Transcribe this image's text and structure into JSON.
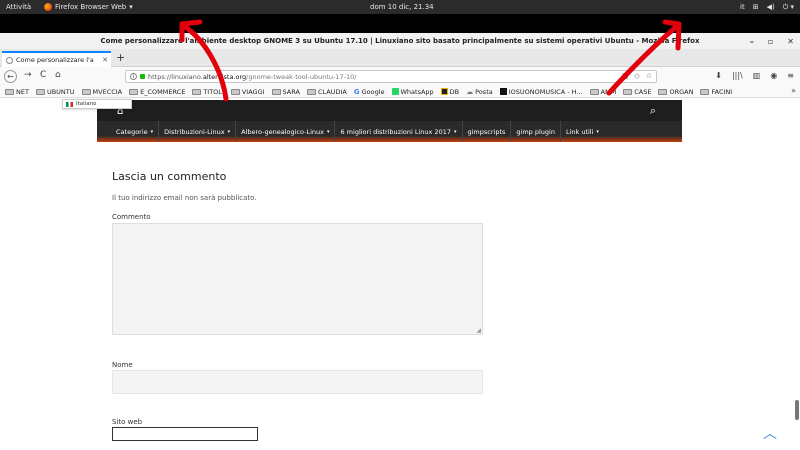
{
  "gnome": {
    "activities": "Attività",
    "app_menu": "Firefox Browser Web",
    "app_menu_caret": "▾",
    "clock": "dom 10 dic, 21.34",
    "lang": "it",
    "tray_net": "⊞",
    "tray_vol": "◀)",
    "tray_power": "⏻ ▾"
  },
  "window": {
    "title": "Come personalizzare l'ambiente desktop GNOME 3 su Ubuntu 17.10 | Linuxiano sito basato principalmente su sistemi operativi Ubuntu - Mozilla Firefox",
    "minimize": "–",
    "maximize": "▫",
    "close": "✕"
  },
  "tabs": [
    {
      "label": "Come personalizzare l'a",
      "close": "✕"
    }
  ],
  "new_tab": "+",
  "nav": {
    "back": "←",
    "forward": "→",
    "reload": "C",
    "home": "⌂",
    "url_prefix": "https://linuxiano.",
    "url_host": "altervista.org",
    "url_path": "/gnome-tweak-tool-ubuntu-17-10/",
    "reader": "▤",
    "pocket": "◇",
    "star": "☆",
    "downloads": "⬇",
    "library": "|||\\",
    "sidebar": "▥",
    "screenshot": "◉",
    "menu": "≡"
  },
  "bookmarks": [
    {
      "label": "NET",
      "icon": "folder"
    },
    {
      "label": "UBUNTU",
      "icon": "folder"
    },
    {
      "label": "MVECCIA",
      "icon": "folder"
    },
    {
      "label": "E_COMMERCE",
      "icon": "folder"
    },
    {
      "label": "TITOLI",
      "icon": "folder"
    },
    {
      "label": "VIAGGI",
      "icon": "folder"
    },
    {
      "label": "SARA",
      "icon": "folder"
    },
    {
      "label": "CLAUDIA",
      "icon": "folder"
    },
    {
      "label": "Google",
      "icon": "google"
    },
    {
      "label": "WhatsApp",
      "icon": "whatsapp"
    },
    {
      "label": "DB",
      "icon": "db"
    },
    {
      "label": "Posta",
      "icon": "mail"
    },
    {
      "label": "IOSUONOMUSICA - H...",
      "icon": "music"
    },
    {
      "label": "AMM",
      "icon": "folder"
    },
    {
      "label": "CASE",
      "icon": "folder"
    },
    {
      "label": "ORGAN",
      "icon": "folder"
    },
    {
      "label": "FACINI",
      "icon": "folder"
    }
  ],
  "bookmarks_more": "»",
  "language_selector": "Italiano",
  "site": {
    "menu": [
      {
        "label": "Categorie",
        "caret": "▾"
      },
      {
        "label": "Distribuzioni-Linux",
        "caret": "▾"
      },
      {
        "label": "Albero-genealogico-Linux",
        "caret": "▾"
      },
      {
        "label": "6 migliori distribuzioni Linux 2017",
        "caret": "▾"
      },
      {
        "label": "gimpscripts",
        "caret": ""
      },
      {
        "label": "gimp plugin",
        "caret": ""
      },
      {
        "label": "Link utili",
        "caret": "▾"
      }
    ]
  },
  "comment_form": {
    "title": "Lascia un commento",
    "note": "Il tuo indirizzo email non sarà pubblicato.",
    "comment_label": "Commento",
    "name_label": "Nome",
    "website_label": "Sito web"
  },
  "colors": {
    "annotation": "#e3000b",
    "menu_accent": "#c4420f",
    "tab_accent": "#0a84ff",
    "back_to_top": "#4a8fd6"
  }
}
